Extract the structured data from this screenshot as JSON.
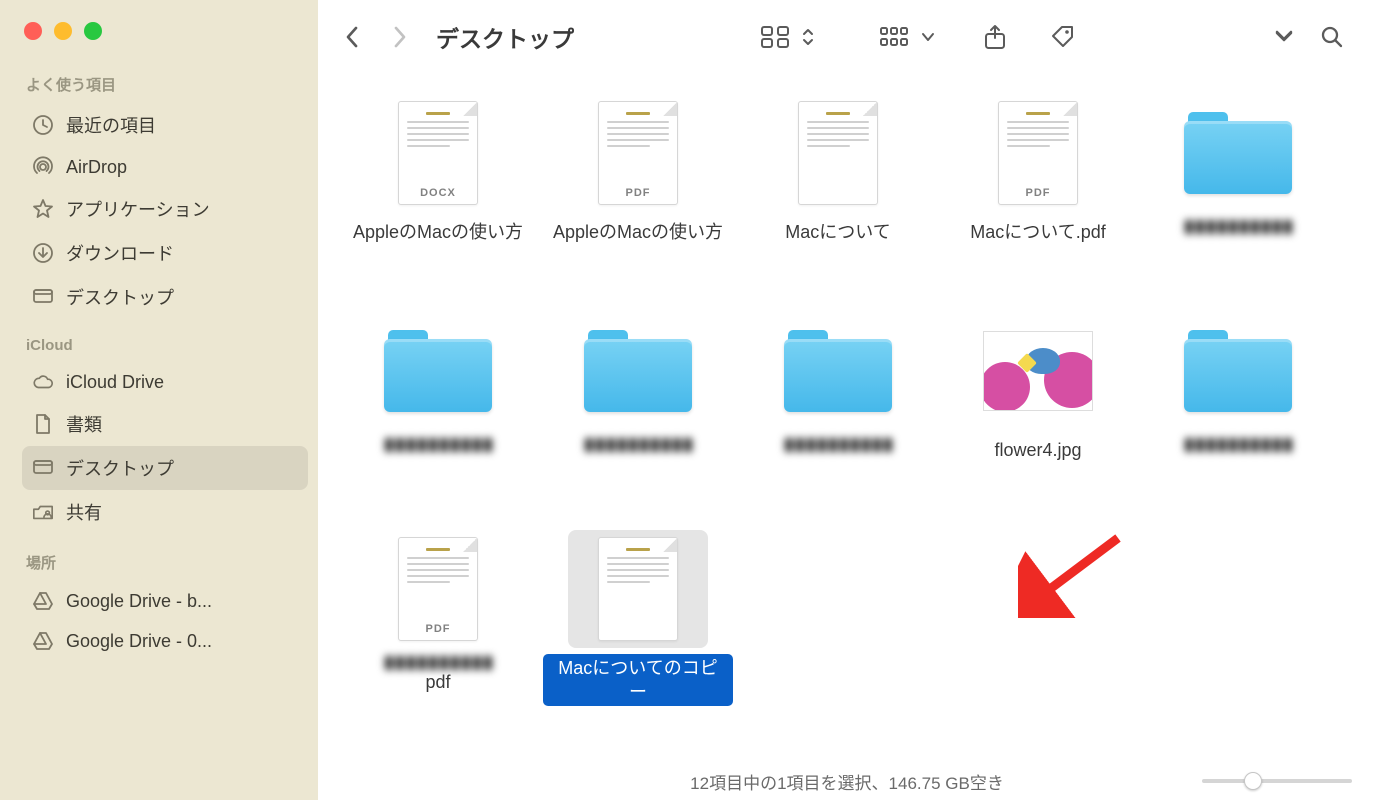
{
  "window": {
    "title": "デスクトップ"
  },
  "sidebar": {
    "sections": {
      "favorites": {
        "title": "よく使う項目",
        "items": [
          {
            "label": "最近の項目",
            "icon": "clock"
          },
          {
            "label": "AirDrop",
            "icon": "airdrop"
          },
          {
            "label": "アプリケーション",
            "icon": "applications"
          },
          {
            "label": "ダウンロード",
            "icon": "downloads"
          },
          {
            "label": "デスクトップ",
            "icon": "desktop"
          }
        ]
      },
      "icloud": {
        "title": "iCloud",
        "items": [
          {
            "label": "iCloud Drive",
            "icon": "cloud"
          },
          {
            "label": "書類",
            "icon": "document"
          },
          {
            "label": "デスクトップ",
            "icon": "desktop",
            "selected": true
          },
          {
            "label": "共有",
            "icon": "shared"
          }
        ]
      },
      "locations": {
        "title": "場所",
        "items": [
          {
            "label": "Google Drive - b...",
            "icon": "gdrive"
          },
          {
            "label": "Google Drive - 0...",
            "icon": "gdrive"
          }
        ]
      }
    }
  },
  "files": [
    {
      "name": "AppleのMacの使い方",
      "type": "doc",
      "badge": "DOCX"
    },
    {
      "name": "AppleのMacの使い方",
      "type": "doc",
      "badge": "PDF"
    },
    {
      "name": "Macについて",
      "type": "doc",
      "badge": ""
    },
    {
      "name": "Macについて.pdf",
      "type": "doc",
      "badge": "PDF"
    },
    {
      "name": "████",
      "type": "folder",
      "censored": true
    },
    {
      "name": "████",
      "type": "folder",
      "censored": true
    },
    {
      "name": "████",
      "type": "folder",
      "censored": true
    },
    {
      "name": "████",
      "type": "folder",
      "censored": true
    },
    {
      "name": "flower4.jpg",
      "type": "image"
    },
    {
      "name": "████",
      "type": "folder",
      "censored": true
    },
    {
      "name": "████.pdf",
      "type": "doc",
      "badge": "PDF",
      "censored": true,
      "suffix": "pdf"
    },
    {
      "name": "Macについてのコピー",
      "type": "doc",
      "badge": "",
      "selected": true
    }
  ],
  "status": {
    "text": "12項目中の1項目を選択、146.75 GB空き"
  }
}
